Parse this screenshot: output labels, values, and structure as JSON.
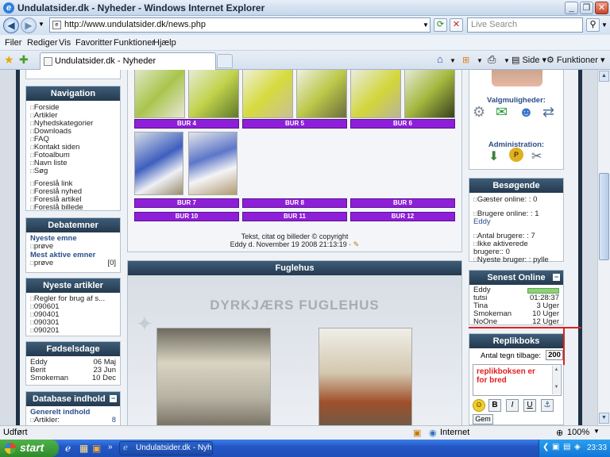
{
  "window": {
    "title": "Undulatsider.dk - Nyheder - Windows Internet Explorer"
  },
  "address": {
    "url": "http://www.undulatsider.dk/news.php",
    "search_placeholder": "Live Search"
  },
  "menu": [
    "Filer",
    "Rediger",
    "Vis",
    "Favoritter",
    "Funktioner",
    "Hjælp"
  ],
  "tab": {
    "label": "Undulatsider.dk - Nyheder"
  },
  "toolbar": {
    "side": "Side",
    "funktioner": "Funktioner"
  },
  "navigation": {
    "title": "Navigation",
    "items": [
      "Forside",
      "Artikler",
      "Nyhedskategorier",
      "Downloads",
      "FAQ",
      "Kontakt siden",
      "Fotoalbum",
      "Navn liste",
      "Søg"
    ],
    "suggest": [
      "Foreslå link",
      "Foreslå nyhed",
      "Foreslå artikel",
      "Foreslå billede"
    ]
  },
  "debate": {
    "title": "Debatemner",
    "newest_label": "Nyeste emne",
    "newest_item": "prøve",
    "active_label": "Mest aktive emner",
    "active_item": "prøve",
    "active_count": "[0]"
  },
  "articles": {
    "title": "Nyeste artikler",
    "items": [
      "Regler for brug af s...",
      "090601",
      "090401",
      "090301",
      "090201"
    ]
  },
  "birthdays": {
    "title": "Fødselsdage",
    "rows": [
      {
        "name": "Eddy",
        "date": "06 Maj"
      },
      {
        "name": "Berit",
        "date": "23 Jun"
      },
      {
        "name": "Smokeman",
        "date": "10 Dec"
      }
    ]
  },
  "db": {
    "title": "Database indhold",
    "general": "Generelt indhold",
    "articles_label": "Artikler:",
    "articles_count": "8"
  },
  "cages": {
    "row1": [
      "BUR 4",
      "BUR 5",
      "BUR 6"
    ],
    "row2": [
      "BUR 7",
      "BUR 8",
      "BUR 9"
    ],
    "row3": [
      "BUR 10",
      "BUR 11",
      "BUR 12"
    ]
  },
  "news_footer": {
    "copyright": "Tekst, citat og billeder © copyright",
    "posted": "Eddy d. November 19 2008 21:13:19 ·"
  },
  "fuglehus": {
    "title": "Fuglehus",
    "heading": "DYRKJÆRS FUGLEHUS"
  },
  "options": {
    "label": "Valgmuligheder:",
    "admin_label": "Administration:"
  },
  "visitors": {
    "title": "Besøgende",
    "guests": "Gæster online: : 0",
    "users_online": "Brugere online: : 1",
    "user": "Eddy",
    "total_users": "Antal brugere: : 7",
    "inactive": "Ikke aktiverede brugere:: 0",
    "newest": "Nyeste bruger: : pylle"
  },
  "last_online": {
    "title": "Senest Online",
    "rows": [
      {
        "name": "Eddy",
        "time": ""
      },
      {
        "name": "tutsi",
        "time": "01:28:37"
      },
      {
        "name": "Tina",
        "time": "3 Uger"
      },
      {
        "name": "Smokeman",
        "time": "10 Uger"
      },
      {
        "name": "NoOne",
        "time": "12 Uger"
      }
    ]
  },
  "shoutbox": {
    "title": "Replikboks",
    "chars_label": "Antal tegn tilbage:",
    "chars_value": "200",
    "text": "replikboksen er for bred",
    "save": "Gem",
    "format_buttons": [
      "B",
      "I",
      "U"
    ]
  },
  "status": {
    "left": "Udført",
    "zone": "Internet",
    "zoom": "100%"
  },
  "taskbar": {
    "start": "start",
    "task": "Undulatsider.dk - Nyh...",
    "clock": "23:33"
  },
  "colors": {
    "accent_purple": "#8e1fd8",
    "panel_header": "#2c4660",
    "annotation_red": "#e02020"
  }
}
